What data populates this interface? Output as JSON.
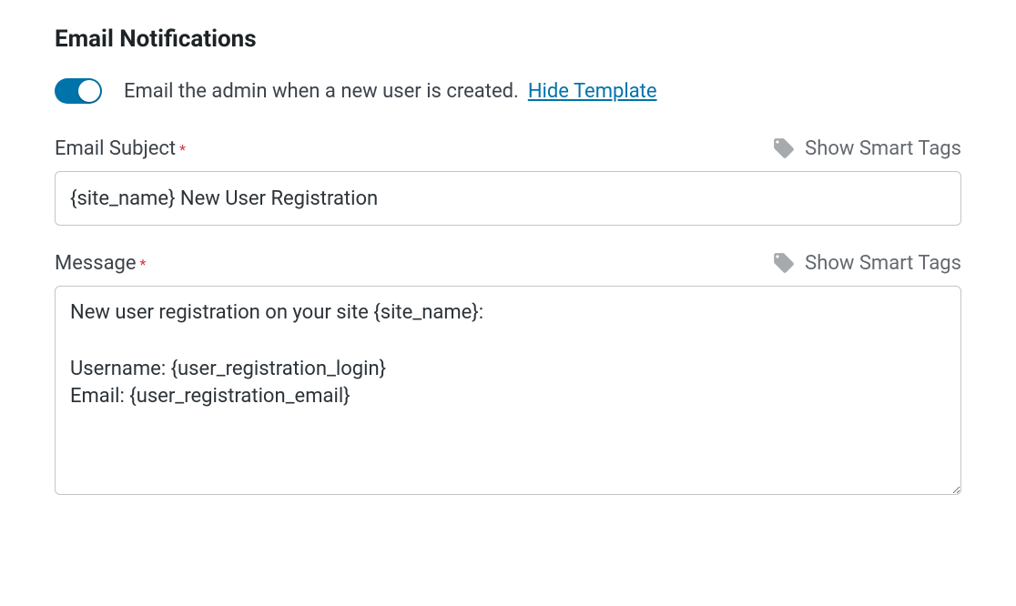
{
  "section": {
    "title": "Email Notifications"
  },
  "toggle": {
    "checked": true,
    "description": "Email the admin when a new user is created.",
    "hide_template_label": "Hide Template"
  },
  "subject": {
    "label": "Email Subject",
    "required_mark": "*",
    "value": "{site_name} New User Registration",
    "smart_tags_label": "Show Smart Tags"
  },
  "message": {
    "label": "Message",
    "required_mark": "*",
    "value": "New user registration on your site {site_name}:\n\nUsername: {user_registration_login}\nEmail: {user_registration_email}",
    "smart_tags_label": "Show Smart Tags"
  }
}
